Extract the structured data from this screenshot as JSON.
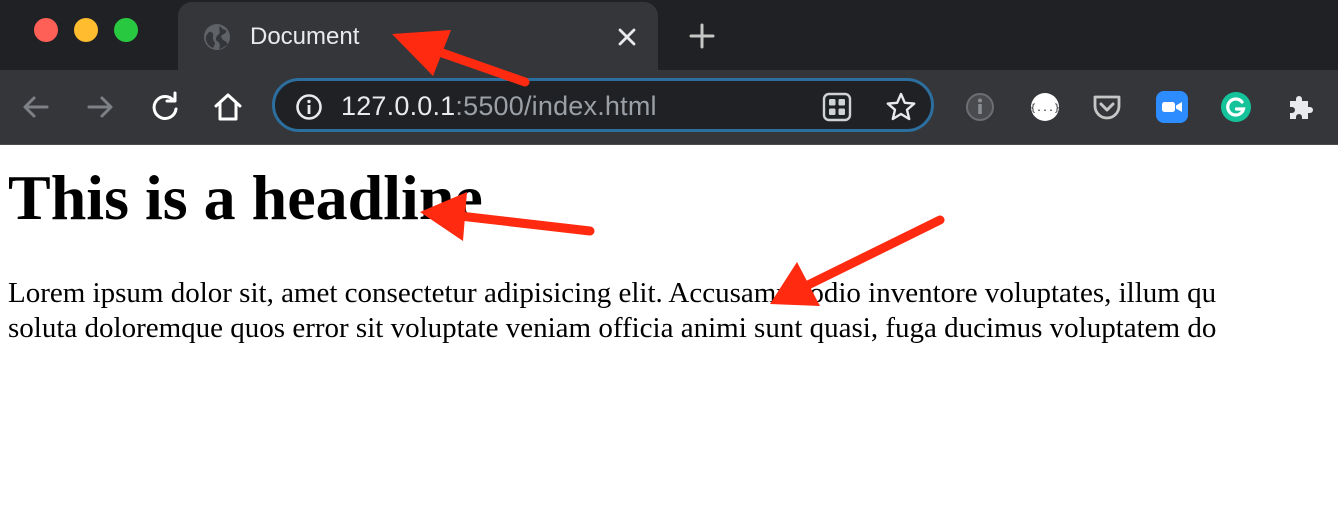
{
  "window": {
    "controls": [
      "close",
      "minimize",
      "maximize"
    ],
    "control_colors": {
      "close": "#fe5f57",
      "minimize": "#febc2e",
      "maximize": "#28c840"
    }
  },
  "tab": {
    "title": "Document",
    "favicon": "globe-icon",
    "close_icon": "close-icon"
  },
  "new_tab_icon": "plus-icon",
  "toolbar": {
    "back_icon": "arrow-left-icon",
    "forward_icon": "arrow-right-icon",
    "reload_icon": "reload-icon",
    "home_icon": "home-icon",
    "omnibox": {
      "info_icon": "info-icon",
      "url_host": "127.0.0.1",
      "url_rest": ":5500/index.html",
      "apps_icon": "qr-apps-icon",
      "star_icon": "star-icon",
      "focus_color": "#2c6f9f"
    },
    "extensions": [
      "extension-info-icon",
      "json-formatter-icon",
      "pocket-icon",
      "zoom-icon",
      "grammarly-icon",
      "puzzle-icon"
    ]
  },
  "page": {
    "headline": "This is a headline",
    "paragraph_line1": "Lorem ipsum dolor sit, amet consectetur adipisicing elit. Accusamus odio inventore voluptates, illum qu",
    "paragraph_line2": "soluta doloremque quos error sit voluptate veniam officia animi sunt quasi, fuga ducimus voluptatem do"
  },
  "annotations": {
    "arrow_color": "#ff2a0f",
    "arrows": [
      "tab-title-arrow",
      "headline-arrow",
      "paragraph-arrow"
    ]
  }
}
